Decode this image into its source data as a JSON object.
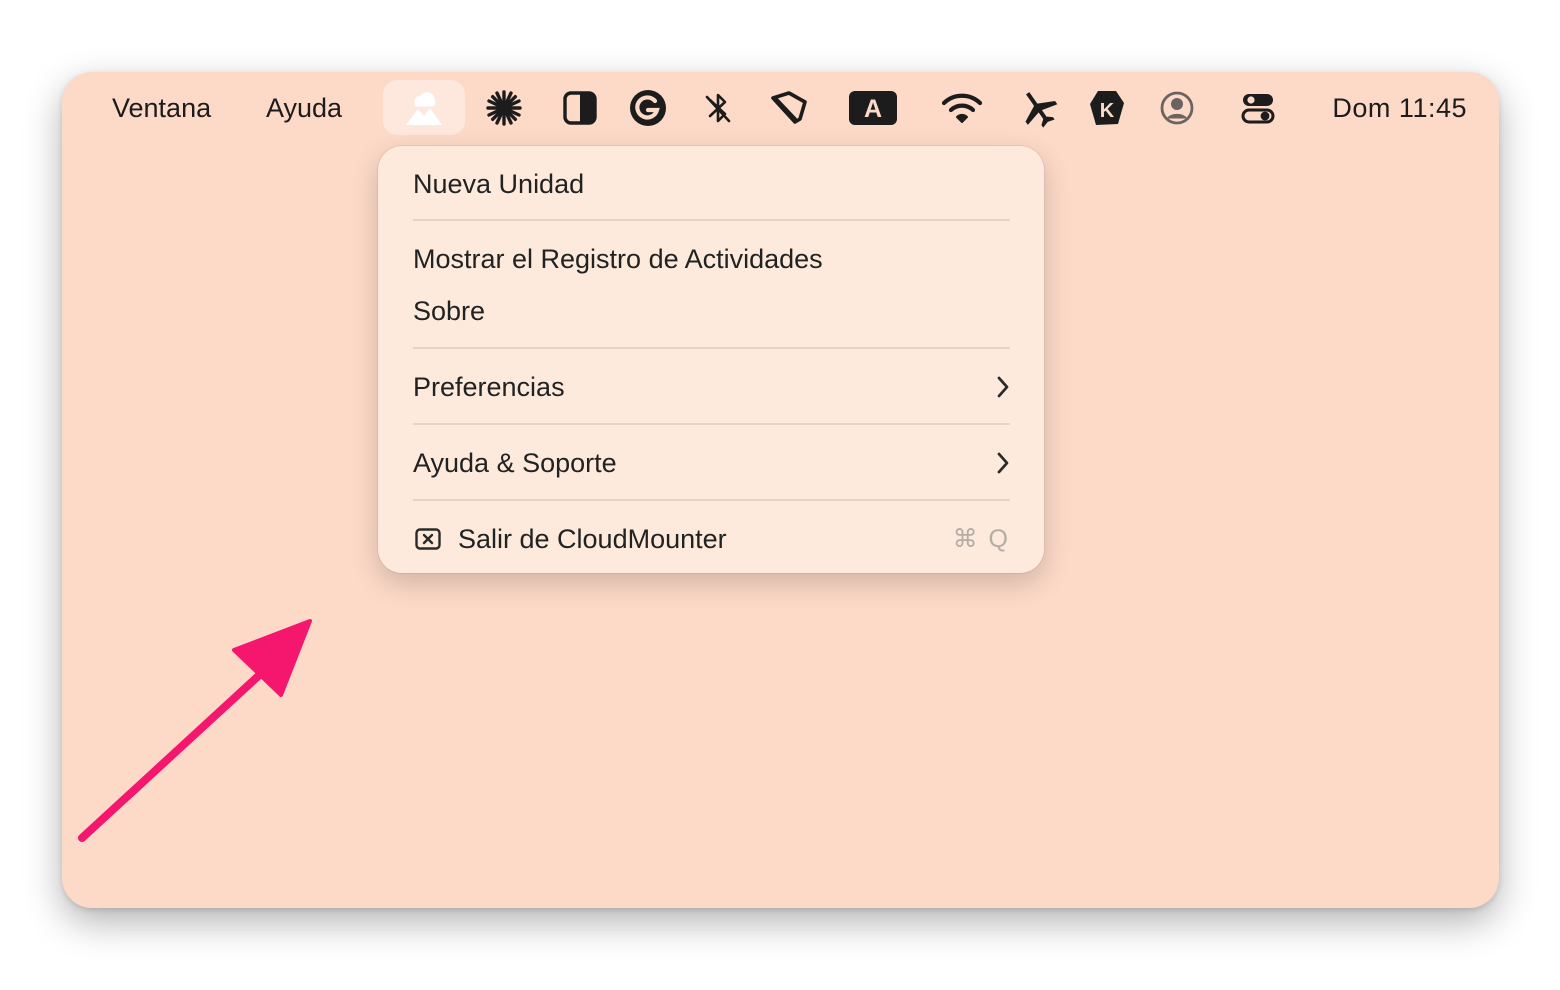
{
  "menubar": {
    "menus": [
      "Ventana",
      "Ayuda"
    ],
    "clock": "Dom 11:45",
    "icons": [
      "cloudmounter-icon",
      "asterisk-icon",
      "contrast-icon",
      "grammarly-icon",
      "bluetooth-icon",
      "pen-tool-icon",
      "keyboard-input-icon",
      "wifi-icon",
      "airplane-icon",
      "kit-icon",
      "user-account-icon",
      "control-center-icon"
    ],
    "keyboard_letter": "A"
  },
  "dropdown": {
    "items": {
      "new_drive": "Nueva Unidad",
      "activity_log": "Mostrar el Registro de Actividades",
      "about": "Sobre",
      "preferences": "Preferencias",
      "help_support": "Ayuda & Soporte",
      "quit": "Salir de CloudMounter"
    },
    "quit_shortcut": "⌘ Q"
  },
  "colors": {
    "background": "#fdd9c7",
    "menu_background": "#fdeadc",
    "annotation_arrow": "#f5166e"
  }
}
